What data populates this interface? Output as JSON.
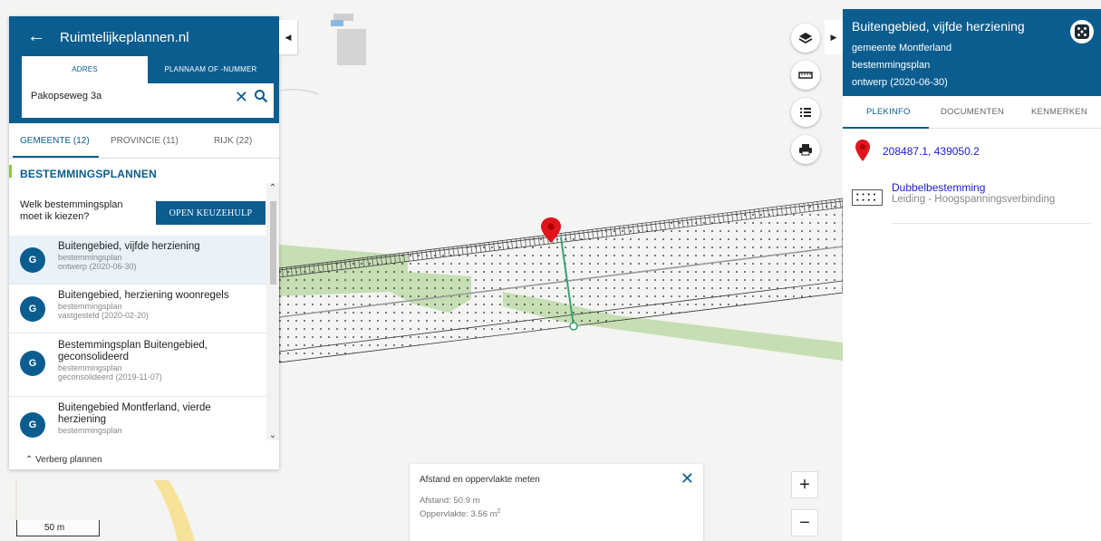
{
  "left_panel": {
    "title": "Ruimtelijkeplannen.nl",
    "search_tabs": [
      "ADRES",
      "PLANNAAM OF -NUMMER"
    ],
    "search_value": "Pakopseweg 3a",
    "scope_tabs": [
      "GEMEENTE (12)",
      "PROVINCIE (11)",
      "RIJK (22)"
    ],
    "section_heading": "BESTEMMINGSPLANNEN",
    "chooser_question": "Welk bestemmingsplan moet ik kiezen?",
    "chooser_button": "OPEN KEUZEHULP",
    "plans": [
      {
        "avatar": "G",
        "name": "Buitengebied, vijfde herziening",
        "type": "bestemmingsplan",
        "status": "ontwerp (2020-06-30)",
        "selected": true
      },
      {
        "avatar": "G",
        "name": "Buitengebied, herziening woonregels",
        "type": "bestemmingsplan",
        "status": "vastgesteld (2020-02-20)",
        "selected": false
      },
      {
        "avatar": "G",
        "name": "Bestemmingsplan Buitengebied, geconsolideerd",
        "type": "bestemmingsplan",
        "status": "geconsolideerd (2019-11-07)",
        "selected": false
      },
      {
        "avatar": "G",
        "name": "Buitengebied Montferland, vierde herziening",
        "type": "bestemmingsplan",
        "status": "",
        "selected": false
      }
    ],
    "hide_plans": "Verberg plannen"
  },
  "right_panel": {
    "title": "Buitengebied, vijfde herziening",
    "municipality": "gemeente Montferland",
    "plan_type": "bestemmingsplan",
    "status": "ontwerp (2020-06-30)",
    "tabs": [
      "PLEKINFO",
      "DOCUMENTEN",
      "KENMERKEN"
    ],
    "coordinates": "208487.1, 439050.2",
    "designation_title": "Dubbelbestemming",
    "designation_sub": "Leiding - Hoogspanningsverbinding"
  },
  "measure": {
    "title": "Afstand en oppervlakte meten",
    "distance": "Afstand: 50.9 m",
    "area_label": "Oppervlakte: 3.56 m",
    "area_unit_exp": "2"
  },
  "scale": {
    "label": "50 m"
  },
  "colors": {
    "brand": "#0b5d8f",
    "link": "#1a1ad6",
    "green_zone": "#c5deb3",
    "pin": "#e0141c",
    "measure_line": "#3aa077"
  }
}
